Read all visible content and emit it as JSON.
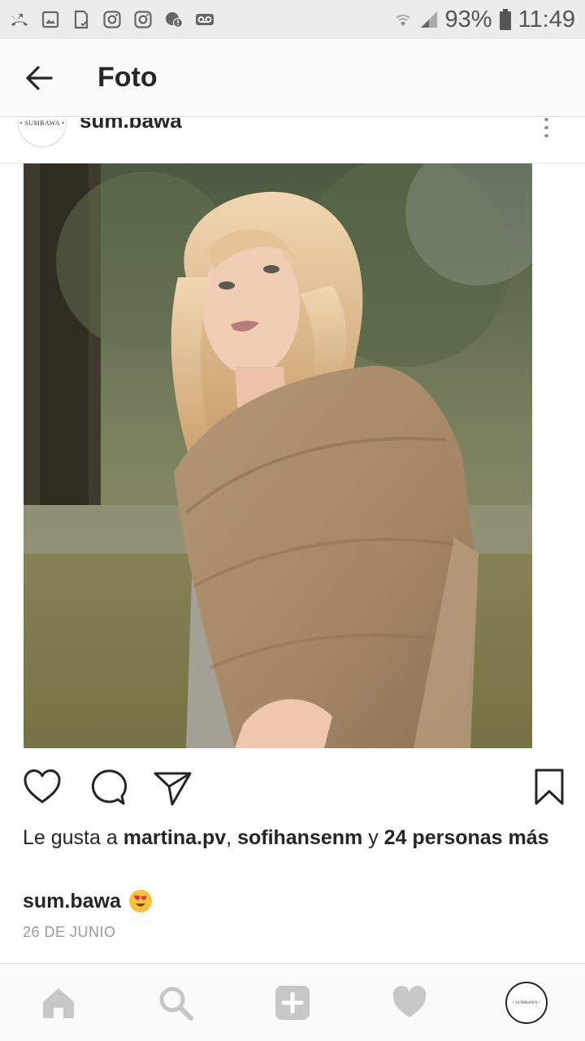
{
  "status_bar": {
    "battery": "93%",
    "time": "11:49",
    "left_icons": [
      "missed-call-icon",
      "gallery-icon",
      "sd-card-icon",
      "instagram-icon",
      "instagram-icon",
      "chat-alert-icon",
      "voicemail-icon"
    ],
    "right_icons": [
      "wifi-icon",
      "signal-icon",
      "battery-icon"
    ]
  },
  "app_bar": {
    "title": "Foto",
    "back_icon": "arrow-left-icon"
  },
  "post": {
    "username": "sum.bawa",
    "avatar_text": "• SUMBAWA •",
    "more_icon": "vertical-dots-icon",
    "likes_prefix": "Le gusta a ",
    "liker_1": "martina.pv",
    "sep": ", ",
    "liker_2": "sofihansenm",
    "and": " y ",
    "others": "24 personas más",
    "caption_user": "sum.bawa",
    "caption_emoji": "heart-eyes-emoji",
    "date": "26 DE JUNIO"
  },
  "actions": {
    "like_icon": "heart-outline-icon",
    "comment_icon": "comment-bubble-icon",
    "share_icon": "send-icon",
    "save_icon": "bookmark-icon"
  },
  "bottom_nav": {
    "items": [
      "home-icon",
      "search-icon",
      "add-post-icon",
      "activity-heart-icon",
      "profile-avatar"
    ],
    "profile_text": "• SUMBAWA •"
  },
  "colors": {
    "status_bar_bg": "#ececec",
    "app_bar_bg": "#fafafa",
    "text": "#262626",
    "muted": "#999999",
    "nav_icon": "#c7c7c7"
  }
}
